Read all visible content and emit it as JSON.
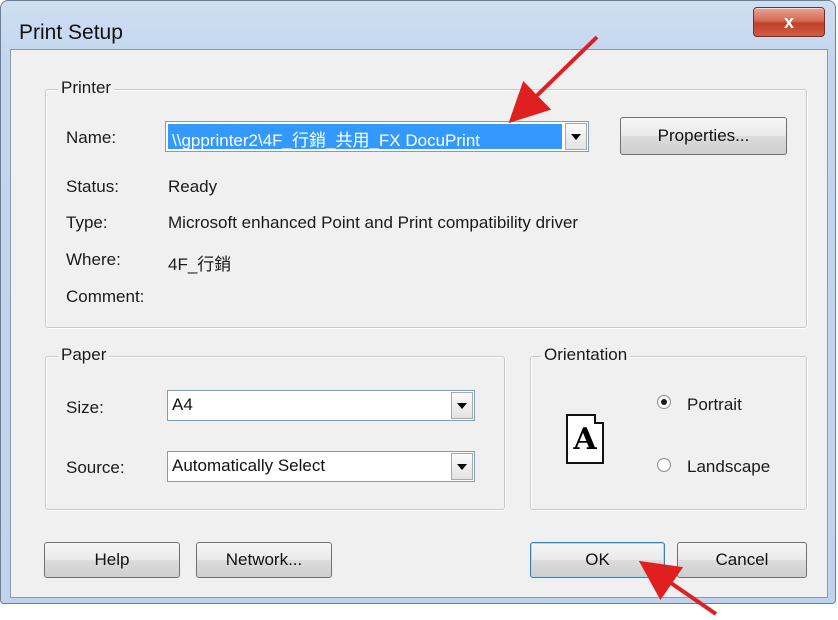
{
  "window": {
    "title": "Print Setup",
    "close_glyph": "x"
  },
  "printer": {
    "legend": "Printer",
    "name_label": "Name:",
    "name_value": "\\\\gpprinter2\\4F_行銷_共用_FX DocuPrint",
    "properties_label": "Properties...",
    "status_label": "Status:",
    "status_value": "Ready",
    "type_label": "Type:",
    "type_value": "Microsoft enhanced Point and Print compatibility driver",
    "where_label": "Where:",
    "where_value": "4F_行銷",
    "comment_label": "Comment:",
    "comment_value": ""
  },
  "paper": {
    "legend": "Paper",
    "size_label": "Size:",
    "size_value": "A4",
    "source_label": "Source:",
    "source_value": "Automatically Select"
  },
  "orientation": {
    "legend": "Orientation",
    "icon_letter": "A",
    "portrait_label": "Portrait",
    "landscape_label": "Landscape",
    "selected": "Portrait"
  },
  "buttons": {
    "help": "Help",
    "network": "Network...",
    "ok": "OK",
    "cancel": "Cancel"
  },
  "annotations": {
    "arrow_color": "#e02020"
  }
}
